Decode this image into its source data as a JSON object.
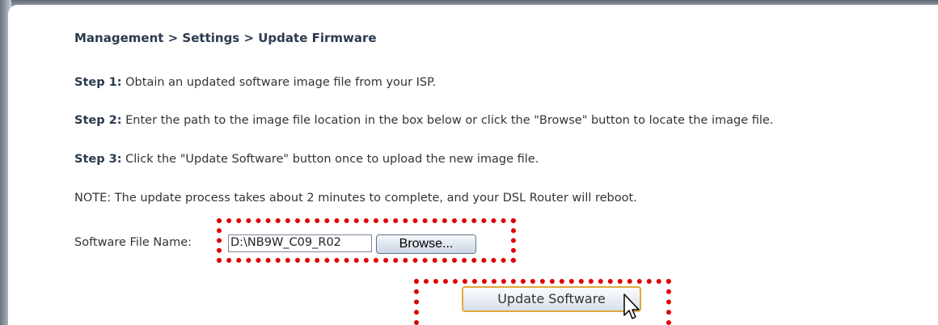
{
  "breadcrumb": "Management > Settings > Update Firmware",
  "steps": [
    {
      "label": "Step 1:",
      "text": " Obtain an updated software image file from your ISP."
    },
    {
      "label": "Step 2:",
      "text": " Enter the path to the image file location in the box below or click the \"Browse\" button to locate the image file."
    },
    {
      "label": "Step 3:",
      "text": " Click the \"Update Software\" button once to upload the new image file."
    }
  ],
  "note": "NOTE: The update process takes about 2 minutes to complete, and your DSL Router will reboot.",
  "file_field": {
    "label": "Software File Name:",
    "value": "D:\\NB9W_C09_R02"
  },
  "browse_label": "Browse...",
  "update_label": "Update Software",
  "colors": {
    "highlight_dots": "#e00000",
    "heading_text": "#2b3a50",
    "button_border_focus": "#e2a83b"
  },
  "icons": [
    "mouse-pointer-icon"
  ]
}
